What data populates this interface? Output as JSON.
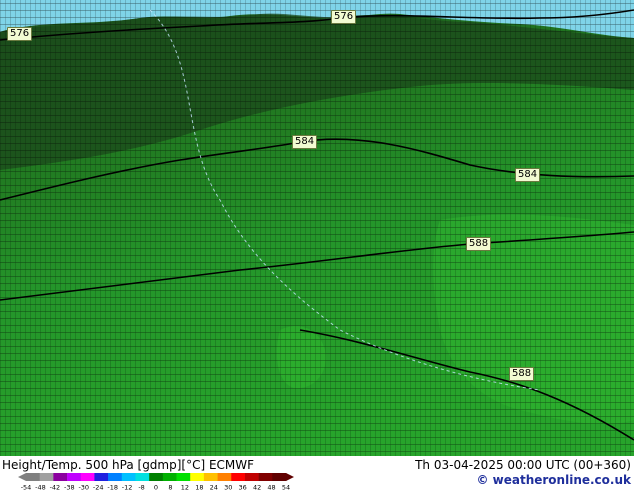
{
  "map": {
    "colors": {
      "cold_band": "#7fd4e8",
      "dark_green": "#1f5c1f",
      "mid_green": "#238c23",
      "bright_green": "#28a428",
      "contour_line": "#000000"
    },
    "contour_labels": [
      {
        "text": "576"
      },
      {
        "text": "576"
      },
      {
        "text": "584"
      },
      {
        "text": "584"
      },
      {
        "text": "588"
      },
      {
        "text": "588"
      }
    ]
  },
  "footer": {
    "title": "Height/Temp. 500 hPa [gdmp][°C] ECMWF",
    "datetime": "Th 03-04-2025 00:00 UTC (00+360)",
    "credit": "© weatheronline.co.uk",
    "scale_ticks": [
      "-54",
      "-48",
      "-42",
      "-38",
      "-30",
      "-24",
      "-18",
      "-12",
      "-8",
      "0",
      "8",
      "12",
      "18",
      "24",
      "30",
      "36",
      "42",
      "48",
      "54"
    ],
    "scale_colors": [
      "#808080",
      "#a0a0a0",
      "#8c00a0",
      "#c000ff",
      "#ff00ff",
      "#2020e0",
      "#0080ff",
      "#00c0ff",
      "#00e0e0",
      "#008000",
      "#00b000",
      "#00e000",
      "#ffff00",
      "#ffc000",
      "#ff8000",
      "#ff0000",
      "#c00000",
      "#800000",
      "#600000"
    ]
  }
}
